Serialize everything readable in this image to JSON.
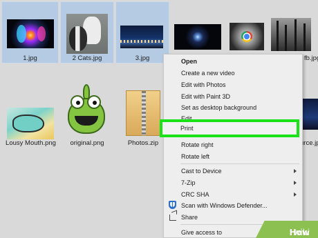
{
  "files": {
    "row1": [
      {
        "name": "1.jpg",
        "selected": true
      },
      {
        "name": "2 Cats.jpg",
        "selected": true
      },
      {
        "name": "3.jpg",
        "selected": true
      },
      {
        "name": "",
        "selected": false
      },
      {
        "name": "",
        "selected": false
      },
      {
        "name": "fb.jpg",
        "selected": false
      }
    ],
    "row2": [
      {
        "name": "Lousy Mouth.png"
      },
      {
        "name": "original.png"
      },
      {
        "name": "Photos.zip"
      },
      {
        "name": "urce.jpg"
      }
    ]
  },
  "context_menu": {
    "open": "Open",
    "create_video": "Create a new video",
    "edit_photos": "Edit with Photos",
    "edit_paint3d": "Edit with Paint 3D",
    "set_background": "Set as desktop background",
    "edit": "Edit",
    "print": "Print",
    "rotate_right": "Rotate right",
    "rotate_left": "Rotate left",
    "cast": "Cast to Device",
    "zip": "7-Zip",
    "crc": "CRC SHA",
    "scan": "Scan with Windows Defender...",
    "share": "Share",
    "give_access": "Give access to"
  },
  "watermark": {
    "wiki": "wiki",
    "how": "How"
  },
  "colors": {
    "highlight": "#19e219",
    "selection": "#b5cbe3"
  }
}
